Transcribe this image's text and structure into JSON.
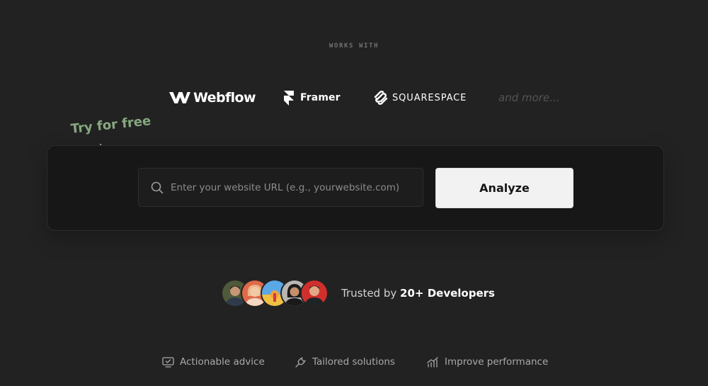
{
  "works_with": {
    "label": "WORKS WITH"
  },
  "platforms": [
    {
      "name": "Webflow",
      "icon": "webflow-logo-icon"
    },
    {
      "name": "Framer",
      "icon": "framer-logo-icon"
    },
    {
      "name": "SQUARESPACE",
      "icon": "squarespace-logo-icon"
    },
    {
      "name": "and more..."
    }
  ],
  "try_free": {
    "label": "Try for free",
    "color": "#86a880"
  },
  "search": {
    "placeholder": "Enter your website URL (e.g., yourwebsite.com)",
    "value": "",
    "icon": "search-icon"
  },
  "analyze_button": {
    "label": "Analyze"
  },
  "trusted": {
    "prefix": "Trusted by",
    "highlight": "20+ Developers",
    "avatar_count": 5
  },
  "features": [
    {
      "label": "Actionable advice",
      "icon": "monitor-check-icon"
    },
    {
      "label": "Tailored solutions",
      "icon": "plug-icon"
    },
    {
      "label": "Improve performance",
      "icon": "bar-chart-trend-icon"
    }
  ],
  "colors": {
    "background": "#232222",
    "panel": "#171717",
    "button": "#f2f2f2",
    "accent_green": "#86a880"
  }
}
